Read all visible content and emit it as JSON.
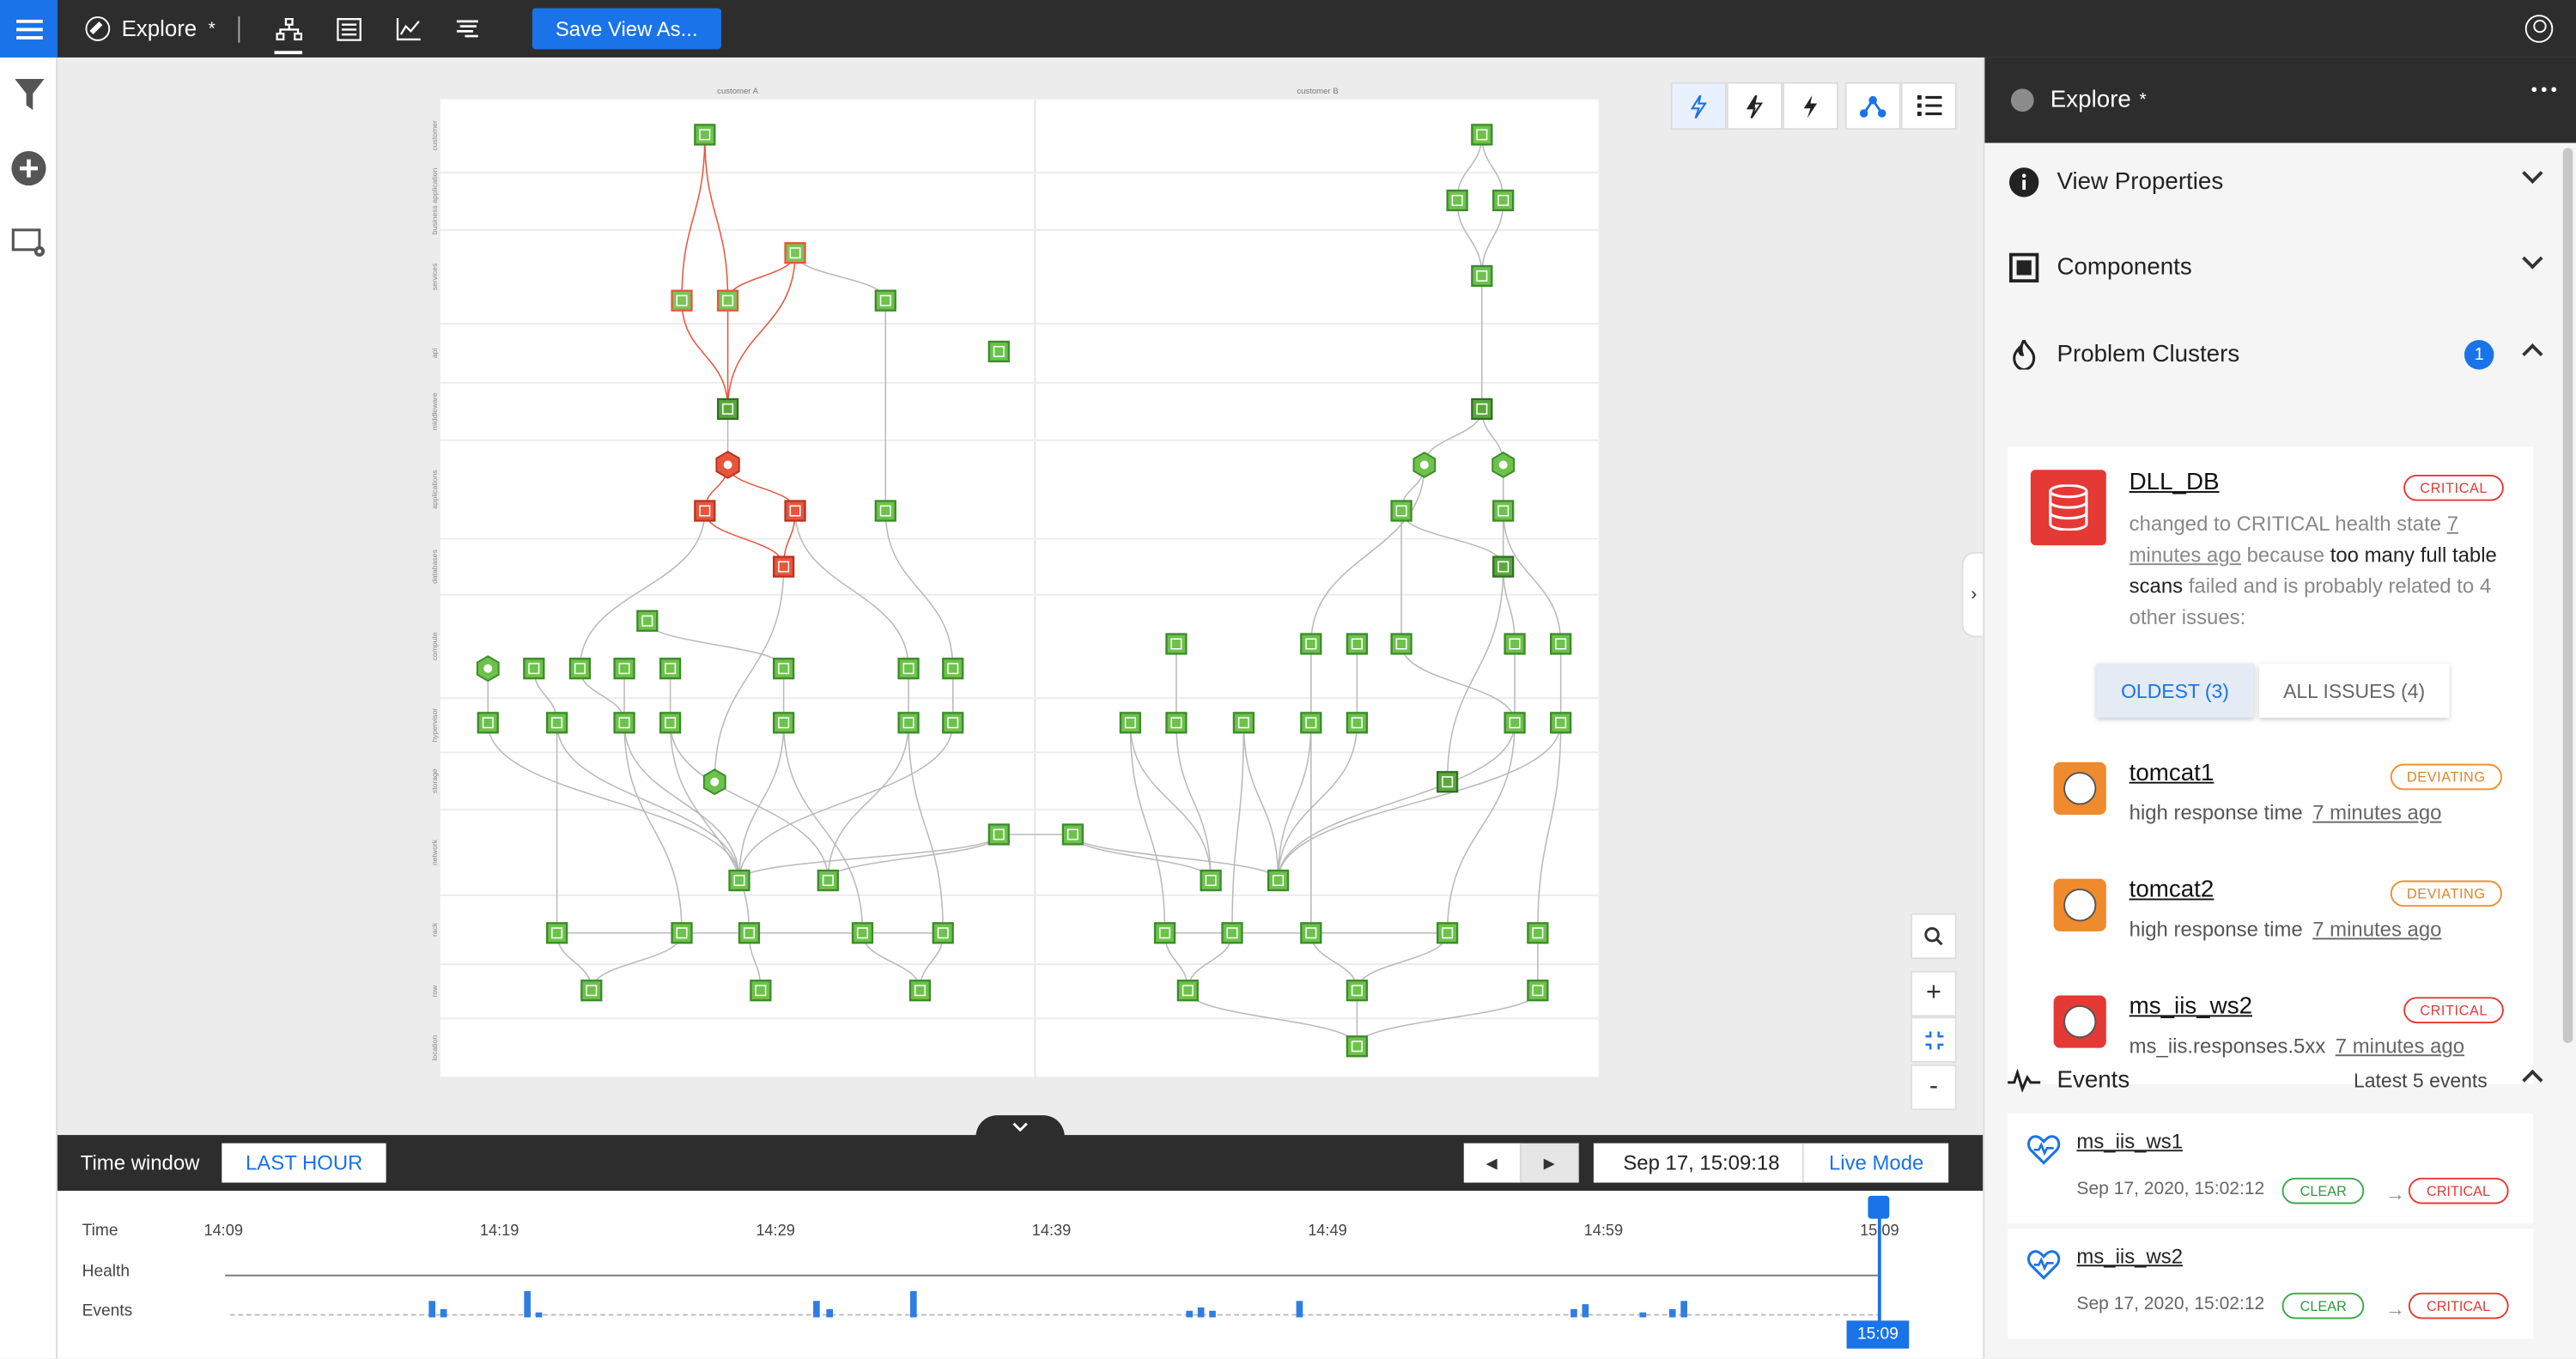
{
  "topbar": {
    "title": "Explore",
    "modified_marker": "*",
    "save_label": "Save View As...",
    "accent": "#1a73e8"
  },
  "canvas": {
    "column_labels": [
      "customer A",
      "customer B"
    ],
    "layer_labels": [
      "customer",
      "business application",
      "services",
      "api",
      "middleware",
      "applications",
      "databases",
      "compute",
      "hypervisor",
      "storage",
      "network",
      "rack",
      "row",
      "location"
    ]
  },
  "zoom": {
    "search": "search-icon",
    "plus": "+",
    "fit": "fit-icon",
    "minus": "-"
  },
  "time_window": {
    "label": "Time window",
    "range": "LAST HOUR",
    "date": "Sep 17, 15:09:18",
    "live": "Live Mode"
  },
  "timeline": {
    "row_time": "Time",
    "row_health": "Health",
    "row_events": "Events",
    "ticks": [
      "14:09",
      "14:19",
      "14:29",
      "14:39",
      "14:49",
      "14:59",
      "15:09"
    ],
    "cursor": "15:09"
  },
  "panel": {
    "title": "Explore",
    "modified_marker": "*",
    "view_properties": "View Properties",
    "components": "Components",
    "problem_clusters": "Problem Clusters",
    "problem_count": "1",
    "cluster": {
      "name": "DLL_DB",
      "status": "CRITICAL",
      "desc_1": "changed to CRITICAL health state",
      "desc_link": "7 minutes ago",
      "desc_2": "because",
      "desc_bold": "too many full table scans",
      "desc_3": "failed and is probably related to 4 other issues:",
      "tab_oldest": "OLDEST (3)",
      "tab_all": "ALL ISSUES (4)"
    },
    "issues": [
      {
        "name": "tomcat1",
        "status": "DEVIATING",
        "desc": "high response time",
        "time": "7 minutes ago"
      },
      {
        "name": "tomcat2",
        "status": "DEVIATING",
        "desc": "high response time",
        "time": "7 minutes ago"
      },
      {
        "name": "ms_iis_ws2",
        "status": "CRITICAL",
        "desc": "ms_iis.responses.5xx",
        "time": "7 minutes ago"
      }
    ],
    "events_title": "Events",
    "events_subtitle": "Latest 5 events",
    "events": [
      {
        "name": "ms_iis_ws1",
        "time": "Sep 17, 2020, 15:02:12",
        "from": "CLEAR",
        "to": "CRITICAL"
      },
      {
        "name": "ms_iis_ws2",
        "time": "Sep 17, 2020, 15:02:12",
        "from": "CLEAR",
        "to": "CRITICAL"
      }
    ]
  }
}
